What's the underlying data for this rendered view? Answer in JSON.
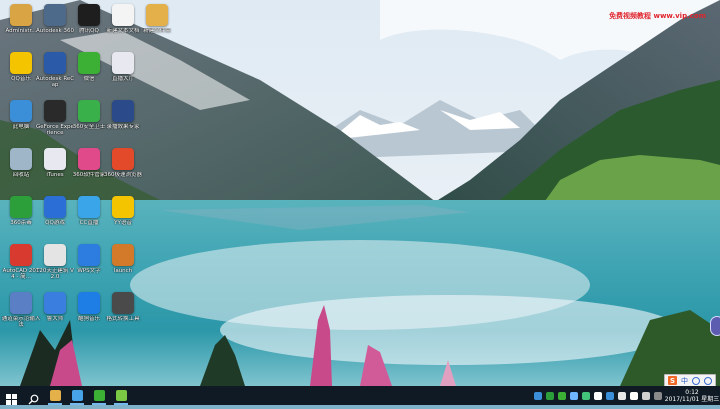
{
  "desktop": {
    "icons": [
      {
        "label": "Administr...",
        "color": "#d9a443",
        "glyph": "user-icon"
      },
      {
        "label": "QQ音乐",
        "color": "#f5c400",
        "glyph": "music-icon"
      },
      {
        "label": "此电脑",
        "color": "#3a8fd8",
        "glyph": "computer-icon"
      },
      {
        "label": "回收站",
        "color": "#9fb6c9",
        "glyph": "recycle-bin-icon"
      },
      {
        "label": "360杀毒",
        "color": "#2d9f3a",
        "glyph": "shield-icon"
      },
      {
        "label": "AutoCAD 2014 - 简...",
        "color": "#d93a2f",
        "glyph": "autocad-icon"
      },
      {
        "label": "通道菜示范输入法",
        "color": "#5a7fc4",
        "glyph": "pen-icon"
      },
      {
        "label": "Autodesk 360",
        "color": "#4d6a8a",
        "glyph": "cloud-icon"
      },
      {
        "label": "Autodesk ReCap",
        "color": "#2a5aa8",
        "glyph": "recap-icon"
      },
      {
        "label": "GeForce Experience",
        "color": "#2a2a2a",
        "glyph": "geforce-icon"
      },
      {
        "label": "iTunes",
        "color": "#e8e8f0",
        "glyph": "itunes-icon"
      },
      {
        "label": "QQ游戏",
        "color": "#2b6fd6",
        "glyph": "qq-game-icon"
      },
      {
        "label": "T20天正建筑 V2.0",
        "color": "#e4e4e4",
        "glyph": "t20-icon"
      },
      {
        "label": "鲁大师",
        "color": "#3a7fe0",
        "glyph": "master-lu-icon"
      },
      {
        "label": "腾讯QQ",
        "color": "#1e1e1e",
        "glyph": "qq-penguin-icon"
      },
      {
        "label": "微信",
        "color": "#3cb034",
        "glyph": "wechat-icon"
      },
      {
        "label": "360安全卫士",
        "color": "#3ab04a",
        "glyph": "plus-shield-icon"
      },
      {
        "label": "360软件管家",
        "color": "#e14a8a",
        "glyph": "apps-grid-icon"
      },
      {
        "label": "CC直播",
        "color": "#3aa5e8",
        "glyph": "ghost-icon"
      },
      {
        "label": "WPS文字",
        "color": "#2d7ce0",
        "glyph": "wps-icon"
      },
      {
        "label": "酷狗音乐",
        "color": "#1e7ee6",
        "glyph": "kugou-icon"
      },
      {
        "label": "新建文本文档",
        "color": "#f4f4f4",
        "glyph": "text-file-icon"
      },
      {
        "label": "直播大厅",
        "color": "#e8e8f0",
        "glyph": "live-icon"
      },
      {
        "label": "录播效果专家",
        "color": "#2a4a8a",
        "glyph": "recorder-icon"
      },
      {
        "label": "360极速浏览器",
        "color": "#e24a2a",
        "glyph": "browser-icon"
      },
      {
        "label": "YY语音",
        "color": "#f5c400",
        "glyph": "yy-icon"
      },
      {
        "label": "launch",
        "color": "#d27a2a",
        "glyph": "launch-icon"
      },
      {
        "label": "格式转换工具",
        "color": "#4a4a4a",
        "glyph": "film-reel-icon"
      },
      {
        "label": "新建文件夹",
        "color": "#e3b04a",
        "glyph": "folder-icon"
      }
    ],
    "watermark": "免费视频教程 www.vip.com"
  },
  "taskbar": {
    "buttons": [
      {
        "name": "start-button",
        "color": "#ffffff"
      },
      {
        "name": "search-button",
        "color": "#ffffff"
      },
      {
        "name": "taskbar-app-explorer",
        "color": "#e3b04a"
      },
      {
        "name": "taskbar-app-files",
        "color": "#48a4e8"
      },
      {
        "name": "taskbar-app-wechat",
        "color": "#3cb034"
      },
      {
        "name": "taskbar-app-360",
        "color": "#7ac843"
      }
    ],
    "tray_icons": [
      "#3a8fd8",
      "#2d9f3a",
      "#3cb034",
      "#6fb6ff",
      "#43c27a",
      "#ffffff",
      "#3a8fd8",
      "#e8e8e8",
      "#ffffff",
      "#d0d0d0",
      "#8a8a8a"
    ],
    "ime": {
      "lang": "中"
    },
    "clock": {
      "time": "0:12",
      "date": "2017/11/01 星期三"
    }
  },
  "colors": {
    "sky": "#cfe3f2",
    "water": "#3aa4b5",
    "taskbar": "#0f1a24"
  }
}
